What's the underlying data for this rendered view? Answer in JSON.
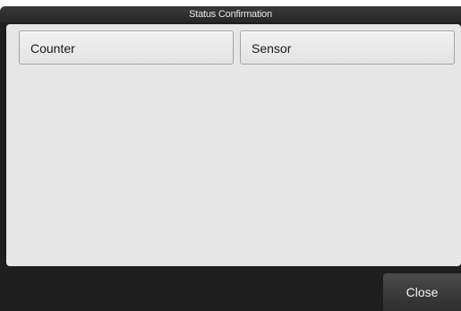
{
  "window": {
    "title": "Status Confirmation"
  },
  "status_buttons": [
    {
      "label": "Counter"
    },
    {
      "label": "Sensor"
    }
  ],
  "footer": {
    "close_label": "Close"
  }
}
